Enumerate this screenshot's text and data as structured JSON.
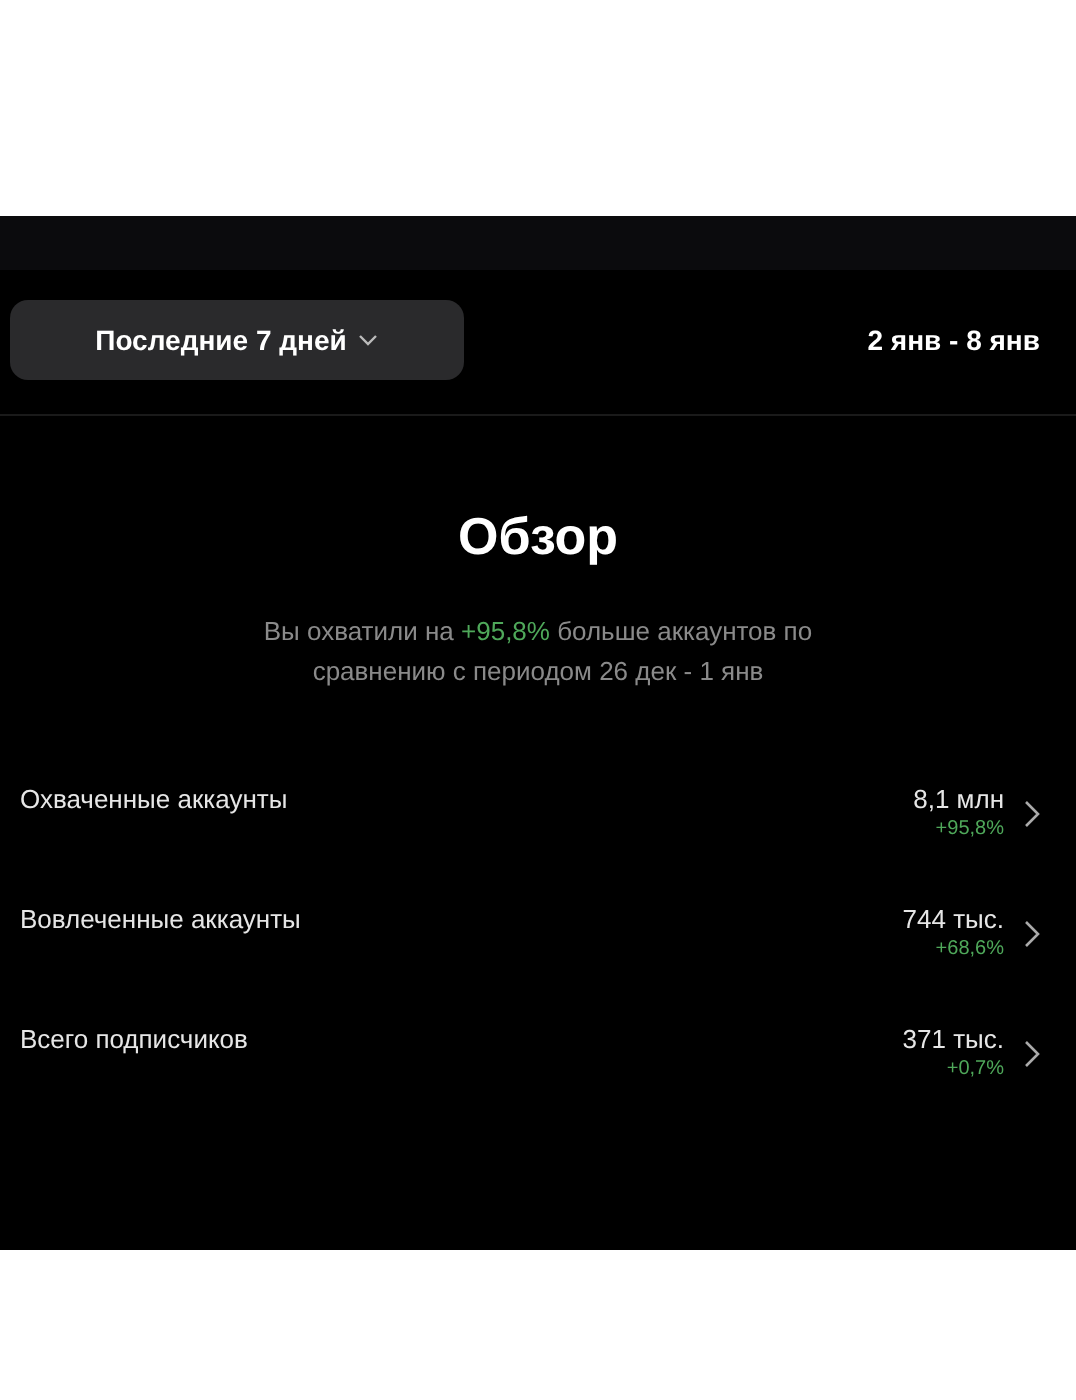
{
  "period_dropdown": {
    "label": "Последние 7 дней"
  },
  "date_range": "2 янв - 8 янв",
  "overview": {
    "title": "Обзор",
    "summary": {
      "before": "Вы охватили на ",
      "highlight": "+95,8%",
      "after": " больше аккаунтов по сравнению с периодом 26 дек - 1 янв"
    }
  },
  "metrics": [
    {
      "label": "Охваченные аккаунты",
      "value": "8,1 млн",
      "change": "+95,8%"
    },
    {
      "label": "Вовлеченные аккаунты",
      "value": "744 тыс.",
      "change": "+68,6%"
    },
    {
      "label": "Всего подписчиков",
      "value": "371 тыс.",
      "change": "+0,7%"
    }
  ]
}
